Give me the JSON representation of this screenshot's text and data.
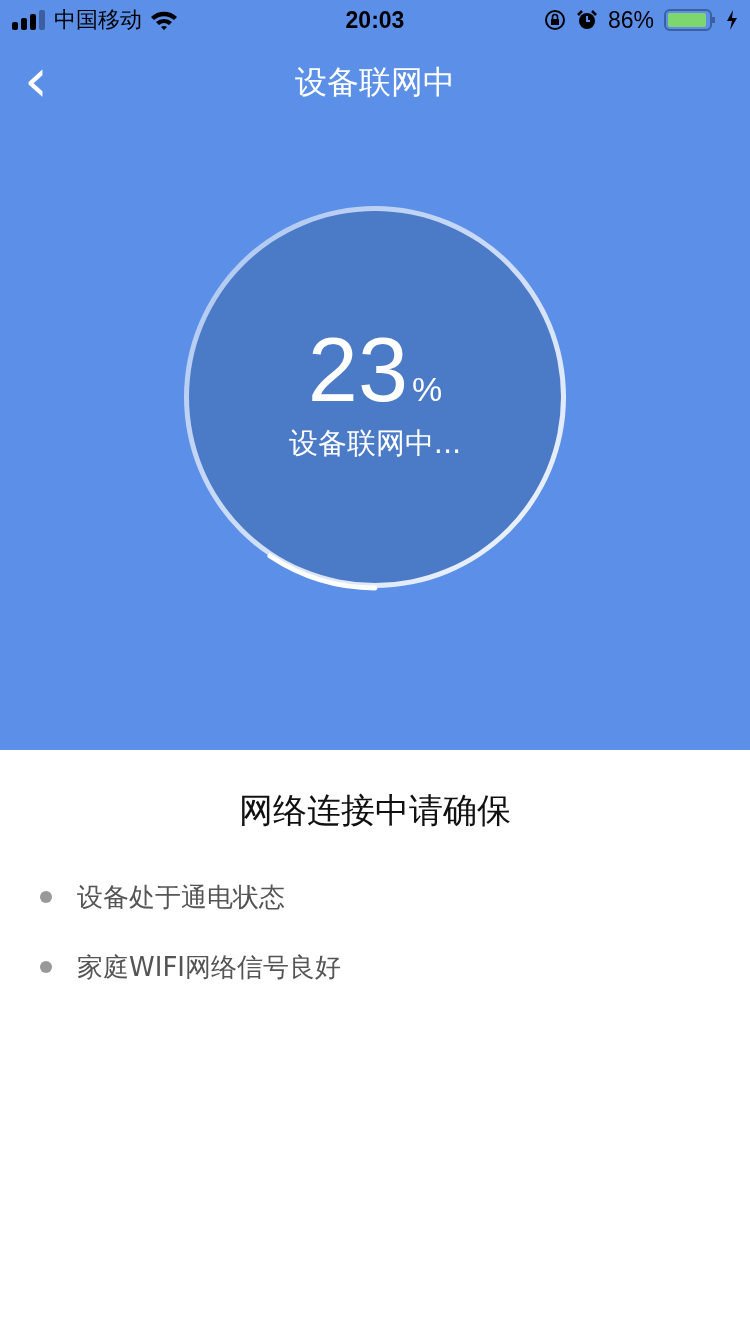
{
  "status_bar": {
    "carrier": "中国移动",
    "time": "20:03",
    "battery": "86%"
  },
  "nav": {
    "back": "‹",
    "title": "设备联网中"
  },
  "progress": {
    "number": "23",
    "unit": "%",
    "caption": "设备联网中..."
  },
  "tips": {
    "heading": "网络连接中请确保",
    "items": [
      "设备处于通电状态",
      "家庭WIFI网络信号良好"
    ]
  }
}
